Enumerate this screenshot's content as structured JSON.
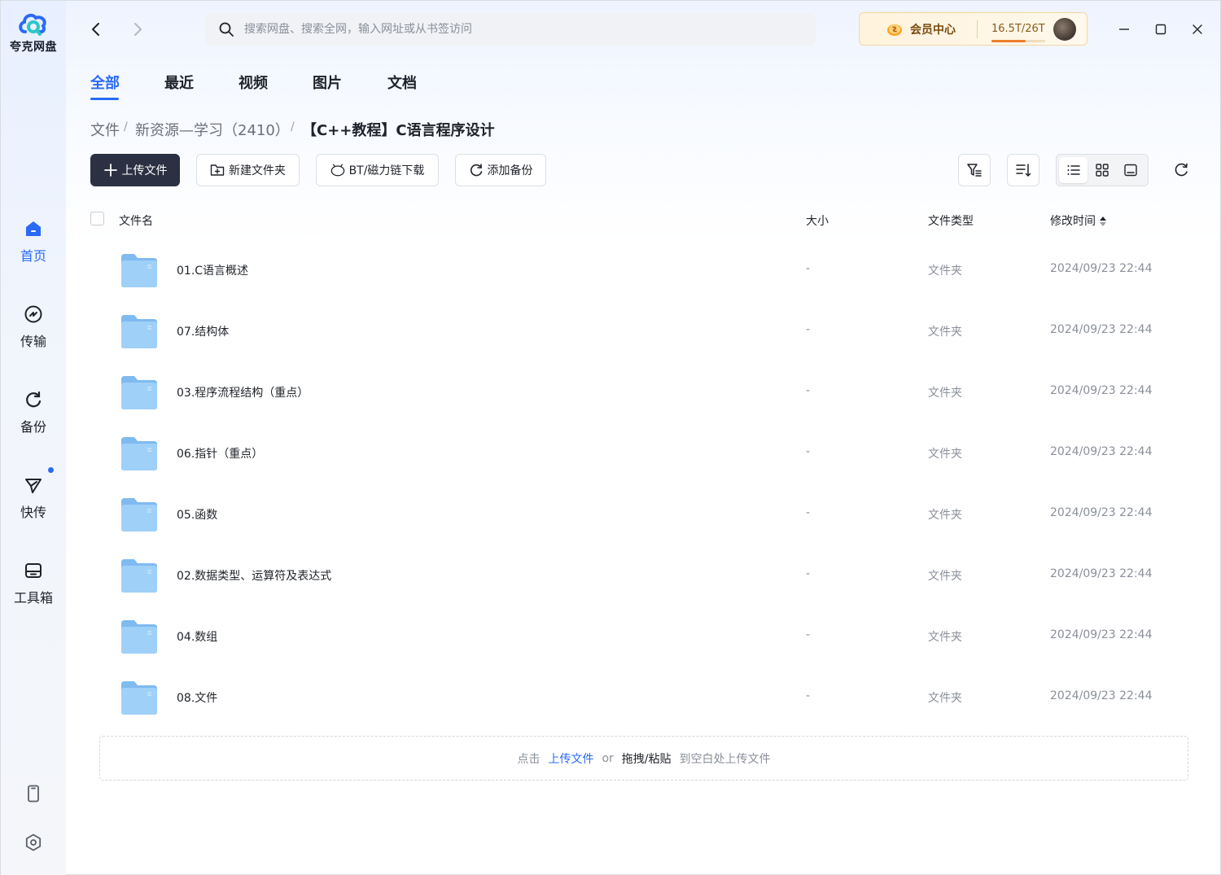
{
  "app": {
    "name": "夸克网盘"
  },
  "colors": {
    "accent": "#2a6af6",
    "primary_button": "#2b3142",
    "folder": "#7fbaf0",
    "vip_text": "#7a4a10",
    "storage_fill": "#ef7f2a"
  },
  "sidebar": {
    "items": [
      {
        "label": "首页",
        "icon": "home-icon",
        "active": true
      },
      {
        "label": "传输",
        "icon": "transfer-icon"
      },
      {
        "label": "备份",
        "icon": "backup-icon"
      },
      {
        "label": "快传",
        "icon": "quick-send-icon",
        "badge": true
      },
      {
        "label": "工具箱",
        "icon": "toolbox-icon"
      }
    ],
    "bottom_icons": [
      "phone-icon",
      "settings-icon"
    ]
  },
  "header": {
    "search_placeholder": "搜索网盘、搜索全网，输入网址或从书签访问",
    "vip_label": "会员中心",
    "storage_text": "16.5T/26T",
    "storage_used_fraction": 0.63
  },
  "tabs": [
    "全部",
    "最近",
    "视频",
    "图片",
    "文档"
  ],
  "breadcrumb": [
    "文件",
    "新资源—学习（2410）",
    "【C++教程】C语言程序设计"
  ],
  "toolbar": {
    "upload": "上传文件",
    "new_folder": "新建文件夹",
    "bt_download": "BT/磁力链下载",
    "add_backup": "添加备份"
  },
  "table": {
    "headers": {
      "name": "文件名",
      "size": "大小",
      "type": "文件类型",
      "modified": "修改时间"
    },
    "rows": [
      {
        "name": "01.C语言概述",
        "size": "-",
        "type": "文件夹",
        "modified": "2024/09/23 22:44"
      },
      {
        "name": "07.结构体",
        "size": "-",
        "type": "文件夹",
        "modified": "2024/09/23 22:44"
      },
      {
        "name": "03.程序流程结构（重点）",
        "size": "-",
        "type": "文件夹",
        "modified": "2024/09/23 22:44"
      },
      {
        "name": "06.指针（重点）",
        "size": "-",
        "type": "文件夹",
        "modified": "2024/09/23 22:44"
      },
      {
        "name": "05.函数",
        "size": "-",
        "type": "文件夹",
        "modified": "2024/09/23 22:44"
      },
      {
        "name": "02.数据类型、运算符及表达式",
        "size": "-",
        "type": "文件夹",
        "modified": "2024/09/23 22:44"
      },
      {
        "name": "04.数组",
        "size": "-",
        "type": "文件夹",
        "modified": "2024/09/23 22:44"
      },
      {
        "name": "08.文件",
        "size": "-",
        "type": "文件夹",
        "modified": "2024/09/23 22:44"
      }
    ]
  },
  "dropzone": {
    "prefix": "点击",
    "link": "上传文件",
    "or": "or",
    "strong": "拖拽/粘贴",
    "suffix": "到空白处上传文件"
  }
}
